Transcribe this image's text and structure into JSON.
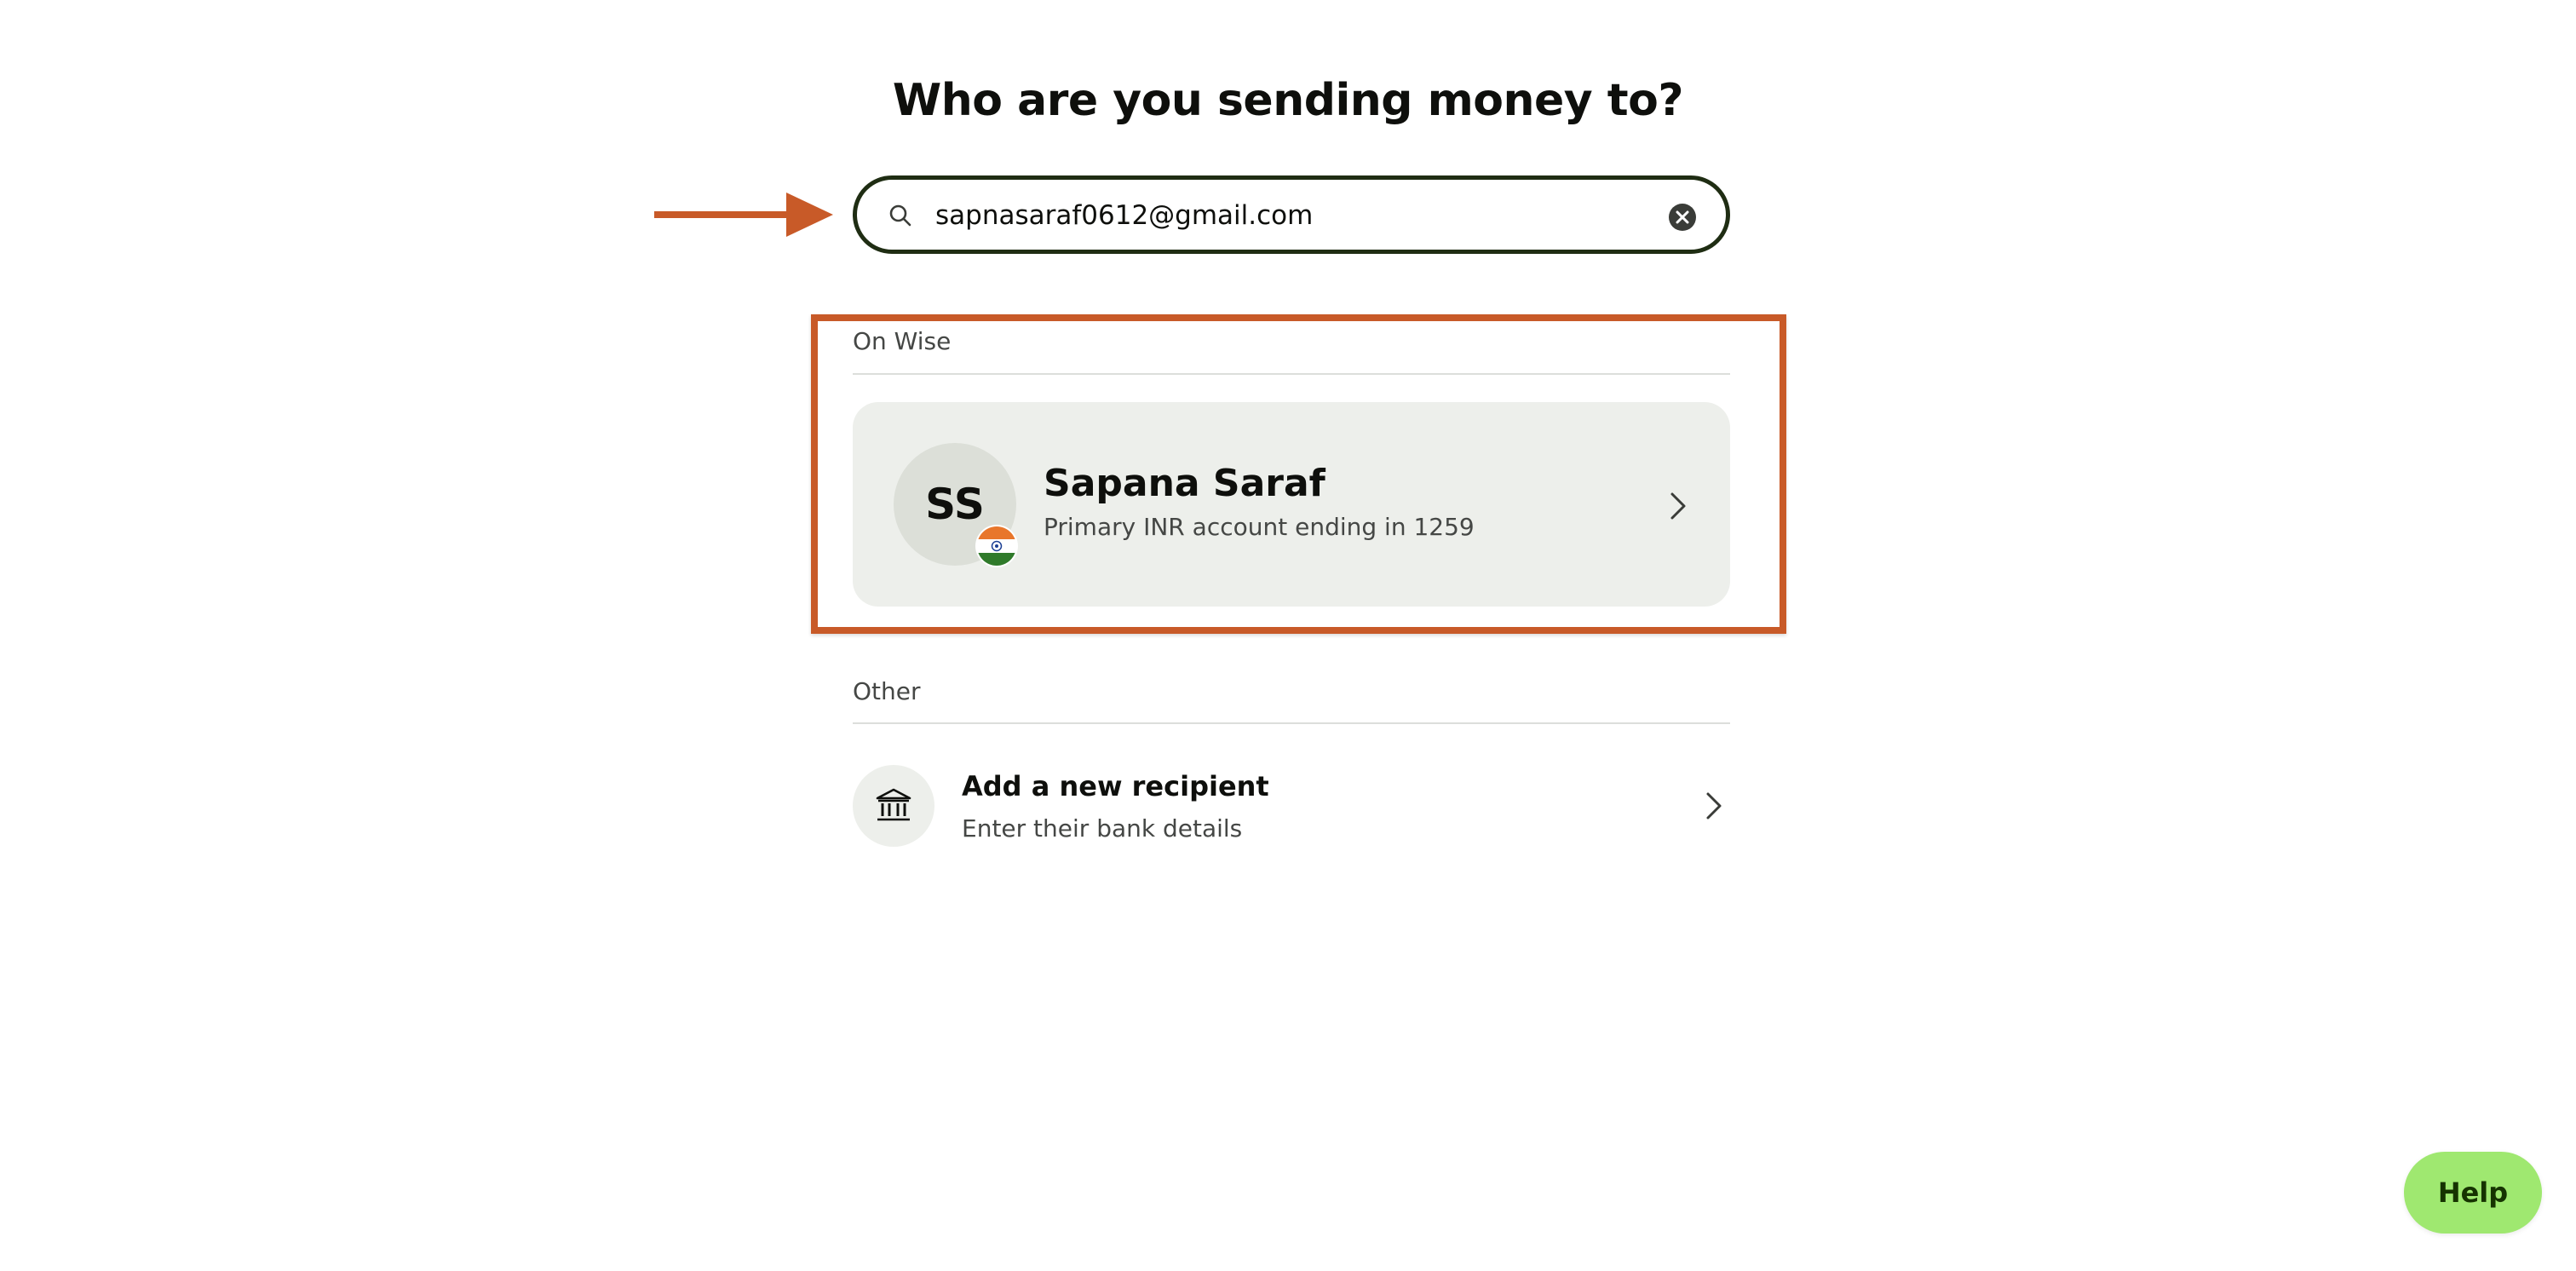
{
  "page": {
    "title": "Who are you sending money to?"
  },
  "search": {
    "value": "sapnasaraf0612@gmail.com",
    "icon": "search-icon",
    "clear_icon": "clear-icon"
  },
  "sections": {
    "on_wise": {
      "label": "On Wise",
      "recipient": {
        "initials": "SS",
        "name": "Sapana Saraf",
        "detail": "Primary INR account ending in 1259",
        "flag_icon": "india-flag-icon"
      }
    },
    "other": {
      "label": "Other",
      "add_recipient": {
        "title": "Add a new recipient",
        "subtitle": "Enter their bank details",
        "icon": "bank-icon"
      }
    }
  },
  "help": {
    "label": "Help"
  },
  "colors": {
    "accent_green": "#9fe870",
    "search_border": "#1f2d13",
    "annotation": "#c85a28",
    "card_bg": "#edefeb"
  }
}
